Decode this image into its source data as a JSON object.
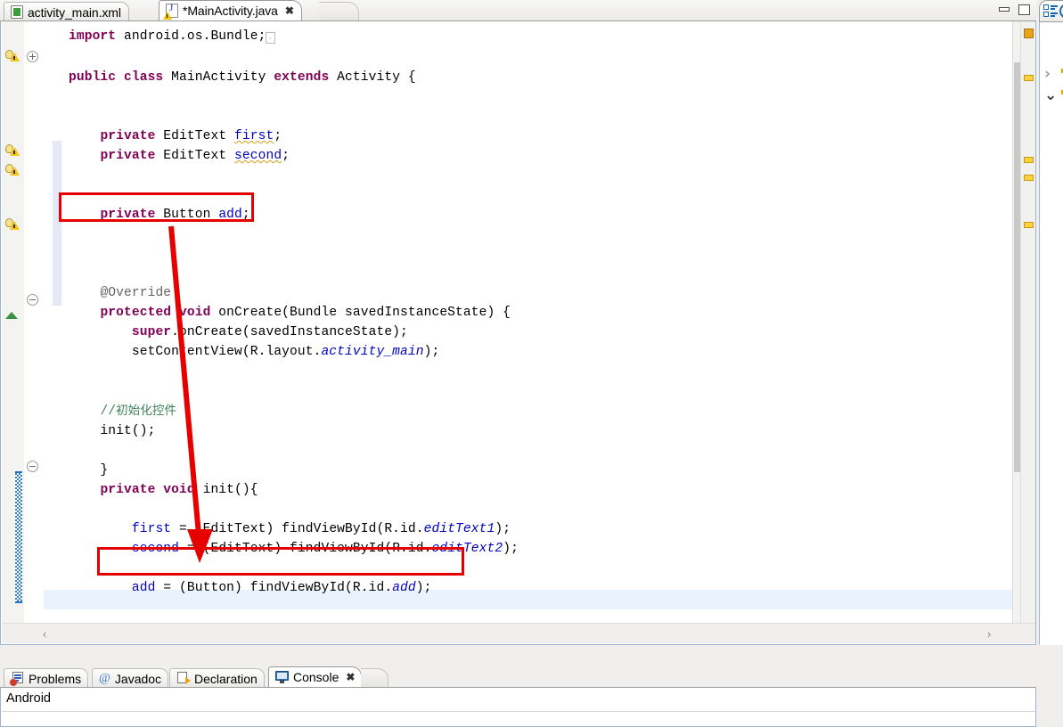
{
  "window": {
    "minimize_label": "Minimize",
    "maximize_label": "Maximize"
  },
  "editor_tabs": [
    {
      "label": "activity_main.xml",
      "icon": "xml-file-icon",
      "active": false,
      "dirty": false,
      "closeable": false
    },
    {
      "label": "*MainActivity.java",
      "icon": "java-file-warning-icon",
      "active": true,
      "dirty": true,
      "close_glyph": "✖"
    }
  ],
  "code": {
    "language": "java",
    "lines": [
      "import android.os.Bundle;",
      "",
      "public class MainActivity extends Activity {",
      "",
      "",
      "    private EditText first;",
      "    private EditText second;",
      "",
      "",
      "    private Button add;",
      "",
      "",
      "",
      "    @Override",
      "    protected void onCreate(Bundle savedInstanceState) {",
      "        super.onCreate(savedInstanceState);",
      "        setContentView(R.layout.activity_main);",
      "",
      "",
      "    //初始化控件",
      "    init();",
      "",
      "    }",
      "    private void init(){",
      "",
      "        first = (EditText) findViewById(R.id.editText1);",
      "        second = (EditText) findViewById(R.id.editText2);",
      "",
      "        add = (Button) findViewById(R.id.add);",
      "",
      "",
      "    }",
      "}"
    ],
    "import_collapsed_glyph": "⊡",
    "comment_text": "//初始化控件"
  },
  "gutter": {
    "warning_icon_name": "warning-quickfix-icon",
    "warning_count": 4,
    "fold_collapse_glyph": "⊖",
    "fold_expand_glyph": "⊕",
    "overview_up_marker": "up-triangle-marker"
  },
  "scrollbars": {
    "v_up_glyph": "∧",
    "v_down_glyph": "∨",
    "h_left_glyph": "‹",
    "h_right_glyph": "›"
  },
  "overview_ruler": {
    "marks": 4,
    "mark_color": "#ffd23c"
  },
  "outline_view": {
    "tab_icon": "outline-view-icon",
    "collapsed_glyph": "›",
    "expanded_glyph": "⌄"
  },
  "bottom_tabs": [
    {
      "label": "Problems",
      "icon": "problems-icon",
      "active": false
    },
    {
      "label": "Javadoc",
      "icon": "at-sign-icon",
      "active": false
    },
    {
      "label": "Declaration",
      "icon": "declaration-icon",
      "active": false
    },
    {
      "label": "Console",
      "icon": "console-icon",
      "active": true,
      "close_glyph": "✖"
    }
  ],
  "console": {
    "content": "Android"
  },
  "annotations": {
    "box_color": "#e60000",
    "arrow_color": "#e60000",
    "box_1_target": "private Button add;",
    "box_2_target": "add = (Button) findViewById(R.id.add);"
  }
}
